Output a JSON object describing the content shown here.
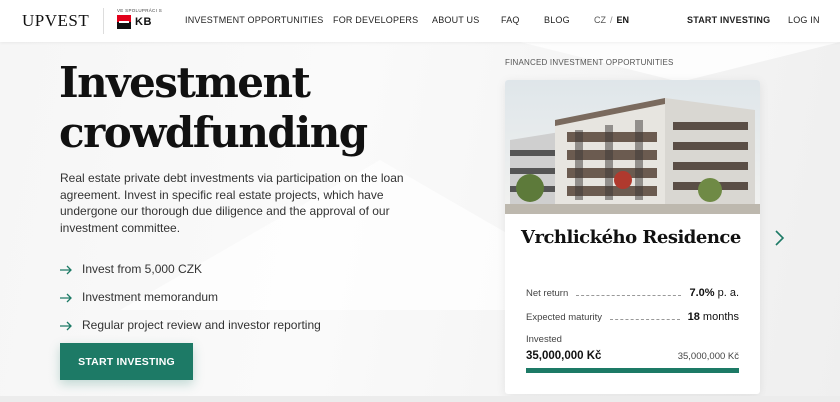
{
  "header": {
    "logo": "UPVEST",
    "partner_caption": "VE SPOLUPRÁCI S",
    "partner_name": "KB",
    "nav": [
      {
        "label": "INVESTMENT OPPORTUNITIES"
      },
      {
        "label": "FOR DEVELOPERS"
      },
      {
        "label": "ABOUT US"
      },
      {
        "label": "FAQ"
      },
      {
        "label": "BLOG"
      }
    ],
    "lang_cz": "CZ",
    "lang_sep": "/",
    "lang_en": "EN",
    "start_investing": "START INVESTING",
    "login": "LOG IN"
  },
  "hero": {
    "title_line1": "Investment",
    "title_line2": "crowdfunding",
    "description": "Real estate private debt investments via participation on the loan agreement. Invest in specific real estate projects, which have undergone our thorough due diligence and the approval of our investment committee.",
    "features": [
      "Invest from 5,000 CZK",
      "Investment memorandum",
      "Regular project review and investor reporting"
    ],
    "cta": "START INVESTING"
  },
  "financed": {
    "section_label": "FINANCED INVESTMENT OPPORTUNITIES",
    "card": {
      "title": "Vrchlického Residence",
      "net_return_label": "Net return",
      "net_return_value": "7.0%",
      "net_return_unit": "p. a.",
      "maturity_label": "Expected maturity",
      "maturity_value": "18",
      "maturity_unit": "months",
      "invested_label": "Invested",
      "invested_value": "35,000,000 Kč",
      "invested_goal": "35,000,000 Kč",
      "progress_fraction": 1.0
    }
  },
  "colors": {
    "accent": "#1d7a66",
    "kb_red": "#e2001a"
  },
  "icons": {
    "feature_bullet": "arrow-right-icon",
    "carousel_next": "chevron-right-icon"
  }
}
